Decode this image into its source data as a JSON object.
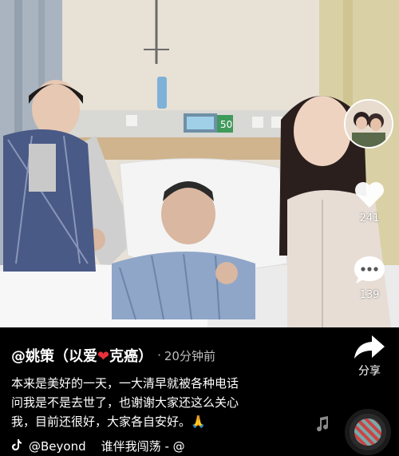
{
  "post": {
    "author_display": "@姚策（以爱",
    "author_heart": "❤",
    "author_suffix": "克癌）",
    "dot": "·",
    "time_ago": "20分钟前",
    "description_lines": [
      "本来是美好的一天，一大清早就被各种电话",
      "问我是不是去世了，也谢谢大家还这么关心",
      "我，目前还很好，大家各自安好。🙏"
    ]
  },
  "actions": {
    "likes": "241",
    "comments": "139",
    "share_label": "分享"
  },
  "music": {
    "text": "@Beyond    谁伴我闯荡 - @"
  },
  "device": {
    "bed_display": "50"
  },
  "colors": {
    "heart_red": "#e8303a",
    "caption_time": "#bdbdbd"
  }
}
